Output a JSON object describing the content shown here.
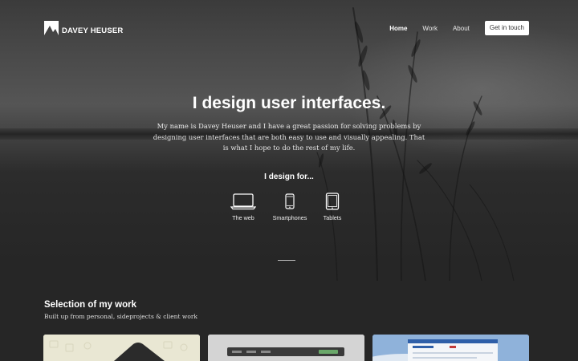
{
  "header": {
    "brand": "DAVEY HEUSER",
    "nav": [
      "Home",
      "Work",
      "About"
    ],
    "cta": "Get in touch"
  },
  "hero": {
    "headline": "I design user interfaces.",
    "intro": "My name is Davey Heuser and I have a great passion for solving problems by designing user interfaces that are both easy to use and visually appealing. That is what I hope to do the rest of my life.",
    "design_for": "I design for...",
    "devices": [
      {
        "label": "The web",
        "icon": "laptop-icon"
      },
      {
        "label": "Smartphones",
        "icon": "smartphone-icon"
      },
      {
        "label": "Tablets",
        "icon": "tablet-icon"
      }
    ]
  },
  "work": {
    "title": "Selection of my work",
    "subtitle": "Built up from personal, sideprojects & client work"
  },
  "colors": {
    "background": "#262626",
    "text": "#ffffff",
    "cta_background": "#ffffff"
  }
}
